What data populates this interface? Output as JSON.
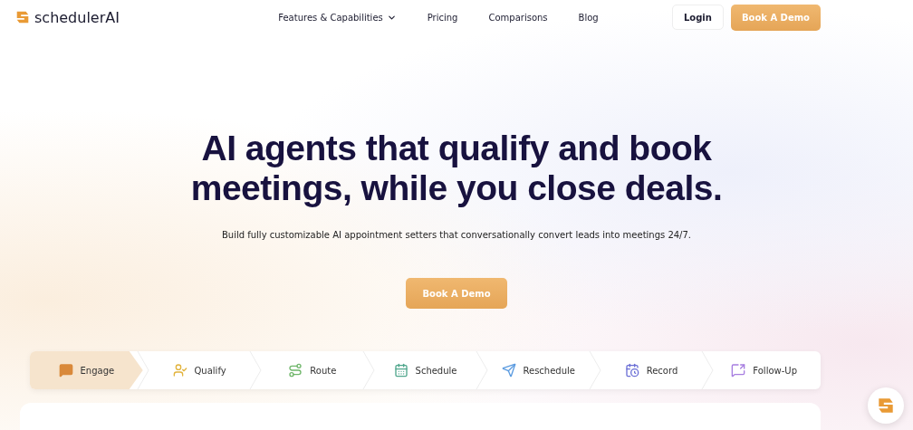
{
  "brand": {
    "name": "schedulerAI"
  },
  "nav": [
    {
      "label": "Features & Capabilities",
      "has_menu": true
    },
    {
      "label": "Pricing",
      "has_menu": false
    },
    {
      "label": "Comparisons",
      "has_menu": false
    },
    {
      "label": "Blog",
      "has_menu": false
    }
  ],
  "actions": {
    "login": "Login",
    "demo": "Book A Demo"
  },
  "hero": {
    "title": "AI agents that qualify and book meetings, while you close deals.",
    "subtitle": "Build fully customizable AI appointment setters that conversationally convert leads into meetings 24/7.",
    "cta": "Book A Demo"
  },
  "steps": [
    {
      "label": "Engage",
      "kind": "chat",
      "color": "#d9893a",
      "selected": true
    },
    {
      "label": "Qualify",
      "kind": "user",
      "color": "#e2b33c",
      "selected": false
    },
    {
      "label": "Route",
      "kind": "route",
      "color": "#6fb66a",
      "selected": false
    },
    {
      "label": "Schedule",
      "kind": "calendar",
      "color": "#4fa68c",
      "selected": false
    },
    {
      "label": "Reschedule",
      "kind": "reschedule",
      "color": "#5b9be0",
      "selected": false
    },
    {
      "label": "Record",
      "kind": "record",
      "color": "#6b6fd6",
      "selected": false
    },
    {
      "label": "Follow-Up",
      "kind": "followup",
      "color": "#a77ee0",
      "selected": false
    }
  ]
}
